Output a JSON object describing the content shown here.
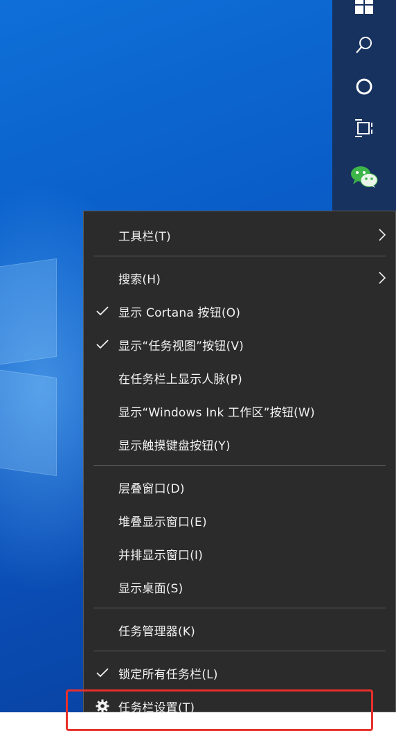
{
  "menu": {
    "items": [
      {
        "label": "工具栏(T)",
        "checked": false,
        "submenu": true
      },
      {
        "label": "搜索(H)",
        "checked": false,
        "submenu": true
      },
      {
        "label": "显示 Cortana 按钮(O)",
        "checked": true,
        "submenu": false
      },
      {
        "label": "显示“任务视图”按钮(V)",
        "checked": true,
        "submenu": false
      },
      {
        "label": "在任务栏上显示人脉(P)",
        "checked": false,
        "submenu": false
      },
      {
        "label": "显示“Windows Ink 工作区”按钮(W)",
        "checked": false,
        "submenu": false
      },
      {
        "label": "显示触摸键盘按钮(Y)",
        "checked": false,
        "submenu": false
      },
      {
        "label": "层叠窗口(D)",
        "checked": false,
        "submenu": false
      },
      {
        "label": "堆叠显示窗口(E)",
        "checked": false,
        "submenu": false
      },
      {
        "label": "并排显示窗口(I)",
        "checked": false,
        "submenu": false
      },
      {
        "label": "显示桌面(S)",
        "checked": false,
        "submenu": false
      },
      {
        "label": "任务管理器(K)",
        "checked": false,
        "submenu": false
      },
      {
        "label": "锁定所有任务栏(L)",
        "checked": true,
        "submenu": false
      },
      {
        "label": "任务栏设置(T)",
        "checked": false,
        "submenu": false,
        "icon": "gear-icon"
      }
    ]
  },
  "taskbar": {
    "icons": [
      "windows-start-icon",
      "search-icon",
      "cortana-icon",
      "task-view-icon",
      "wechat-icon"
    ]
  },
  "colors": {
    "menu_bg": "#2b2b2b",
    "taskbar_bg": "#17325e",
    "highlight": "#e8302b",
    "wechat_green": "#3eb549"
  }
}
